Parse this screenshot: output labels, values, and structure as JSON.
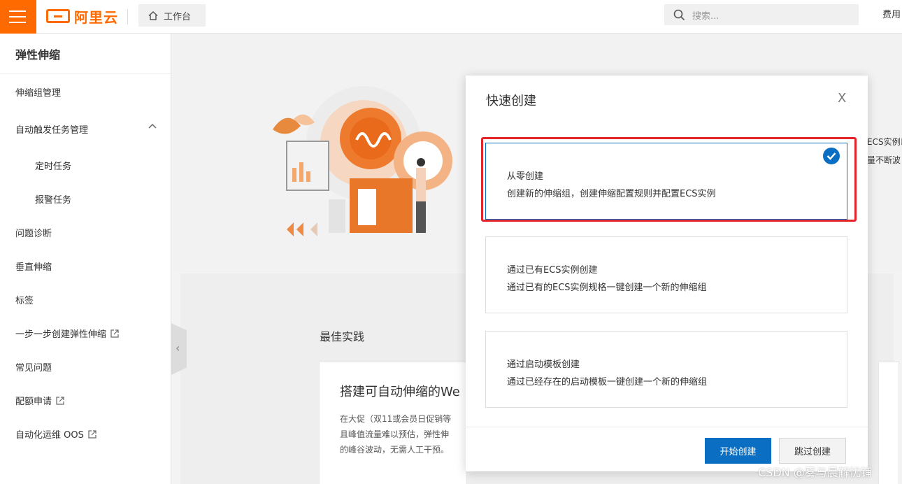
{
  "brand": {
    "logo_text": "阿里云",
    "accent": "#ff6a00"
  },
  "header": {
    "workbench_label": "工作台",
    "search_placeholder": "搜索...",
    "fee_label": "费用"
  },
  "sidebar": {
    "title": "弹性伸缩",
    "items": [
      {
        "label": "伸缩组管理"
      },
      {
        "label": "自动触发任务管理"
      },
      {
        "label": "定时任务"
      },
      {
        "label": "报警任务"
      },
      {
        "label": "问题诊断"
      },
      {
        "label": "垂直伸缩"
      },
      {
        "label": "标签"
      },
      {
        "label": "一步一步创建弹性伸缩"
      },
      {
        "label": "常见问题"
      },
      {
        "label": "配额申请"
      },
      {
        "label": "自动化运维 OOS"
      }
    ]
  },
  "main": {
    "right_edge_line1": "ECS实例以",
    "right_edge_line2": "量不断波",
    "best_practice_title": "最佳实践",
    "card_title": "搭建可自动伸缩的We",
    "card_desc_line1": "在大促（双11或会员日促销等",
    "card_desc_line2": "且峰值流量难以预估，弹性伸",
    "card_desc_line3": "的峰谷波动，无需人工干预。"
  },
  "modal": {
    "title": "快速创建",
    "close": "X",
    "options": [
      {
        "title": "从零创建",
        "desc": "创建新的伸缩组，创建伸缩配置规则并配置ECS实例",
        "selected": true
      },
      {
        "title": "通过已有ECS实例创建",
        "desc": "通过已有的ECS实例规格一键创建一个新的伸缩组",
        "selected": false
      },
      {
        "title": "通过启动模板创建",
        "desc": "通过已经存在的启动模板一键创建一个新的伸缩组",
        "selected": false
      }
    ],
    "primary_button": "开始创建",
    "secondary_button": "跳过创建"
  },
  "watermark": "CSDN @雾与晨解忧铺"
}
